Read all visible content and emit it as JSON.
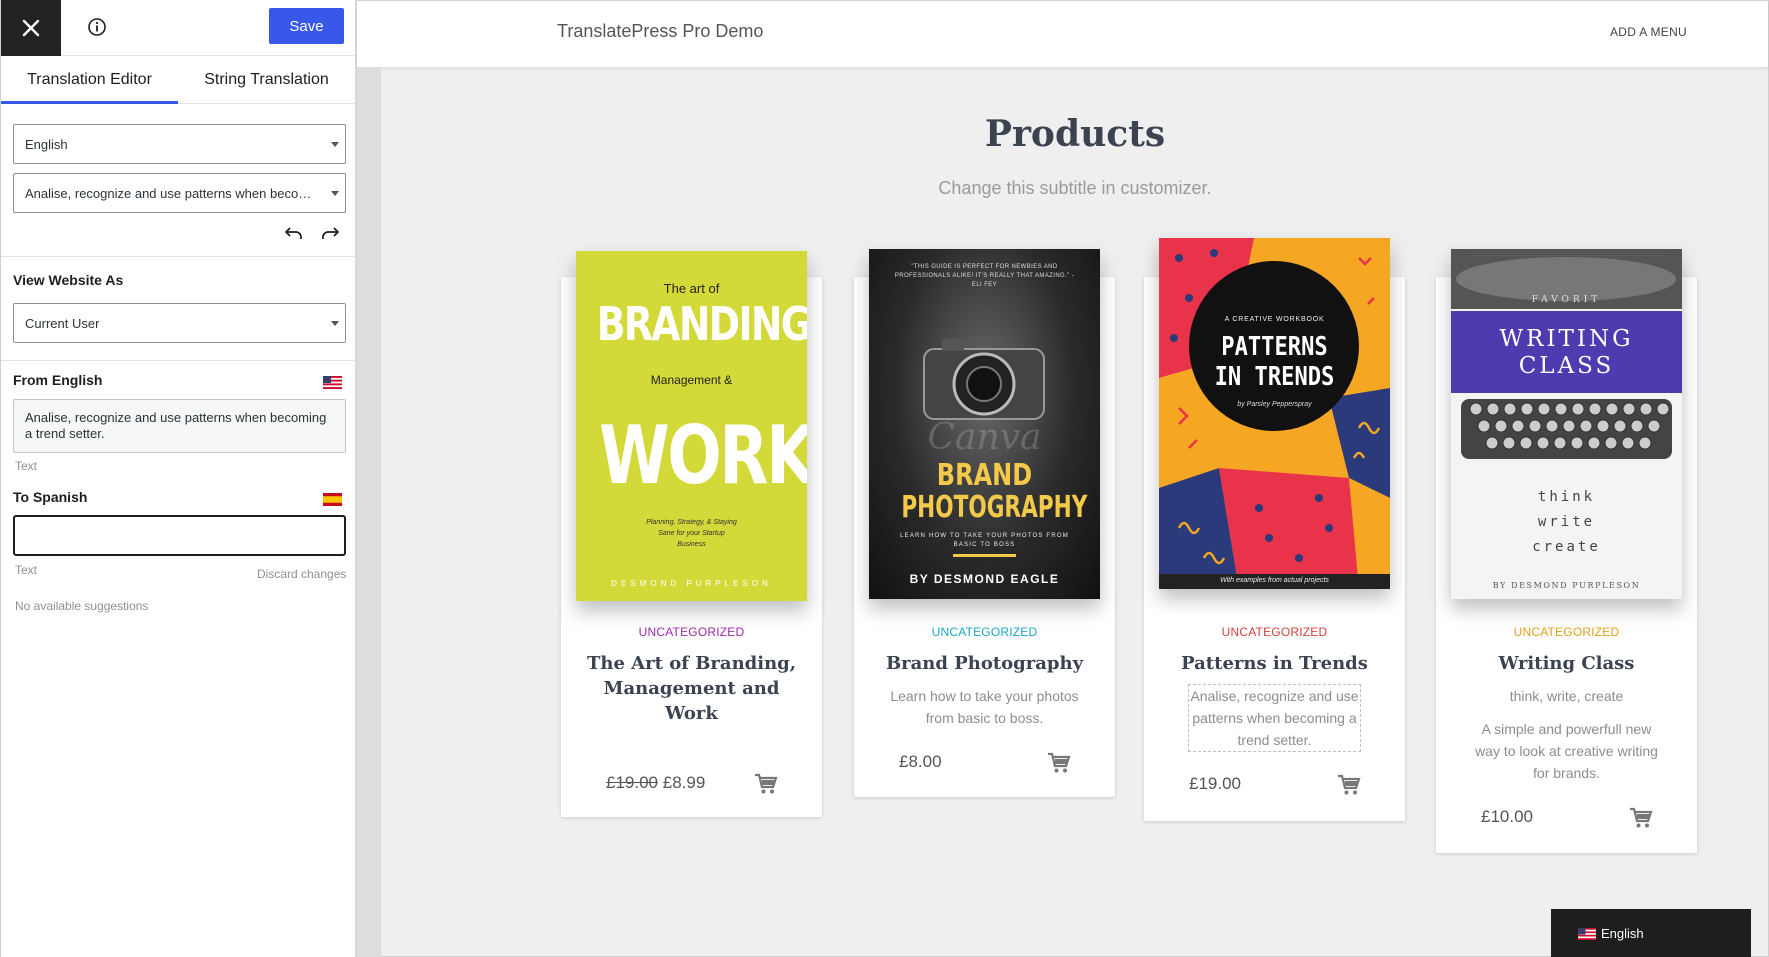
{
  "sidebar": {
    "save_label": "Save",
    "tabs": [
      {
        "label": "Translation Editor",
        "active": true
      },
      {
        "label": "String Translation",
        "active": false
      }
    ],
    "language_select": "English",
    "string_select": "Analise, recognize and use patterns when becoming a trend setter.",
    "view_as_label": "View Website As",
    "view_as_select": "Current User",
    "from_label": "From English",
    "from_text": "Analise, recognize and use patterns when becoming a trend setter.",
    "from_hint": "Text",
    "to_label": "To Spanish",
    "to_value": "",
    "to_hint": "Text",
    "discard_label": "Discard changes",
    "suggestions": "No available suggestions"
  },
  "site": {
    "title": "TranslatePress Pro Demo",
    "menu": "ADD A MENU",
    "page_title": "Products",
    "page_subtitle": "Change this subtitle in customizer.",
    "products": [
      {
        "category": "UNCATEGORIZED",
        "category_color": "#9b2aa8",
        "name": "The Art of Branding, Management and Work",
        "description": "",
        "old_price": "£19.00",
        "price": "£8.99",
        "cover": {
          "bg": "#d4d93a",
          "top": "The art of",
          "big1": "BRANDING",
          "mid": "Management &",
          "big2": "WORK",
          "small": "Planning, Strategy, & Staying Sane for your Startup Business",
          "author": "DESMOND PURPLESON"
        }
      },
      {
        "category": "UNCATEGORIZED",
        "category_color": "#1ca7c4",
        "name": "Brand Photography",
        "description": "Learn how to take your photos from basic to boss.",
        "old_price": "",
        "price": "£8.00",
        "cover": {
          "bg": "#1a1a1a",
          "quote": "\"THIS GUIDE IS PERFECT FOR NEWBIES AND PROFESSIONALS ALIKE! IT'S REALLY THAT AMAZING.\" - ELI FEY",
          "title1": "BRAND",
          "title2": "PHOTOGRAPHY",
          "tagline": "LEARN HOW TO TAKE YOUR PHOTOS FROM BASIC TO BOSS",
          "author": "BY DESMOND EAGLE",
          "watermark": "Canva"
        }
      },
      {
        "category": "UNCATEGORIZED",
        "category_color": "#d6403a",
        "name": "Patterns in Trends",
        "description": "Analise, recognize and use patterns when becoming a trend setter.",
        "old_price": "",
        "price": "£19.00",
        "cover": {
          "kicker": "A CREATIVE WORKBOOK",
          "title1": "PATTERNS",
          "title2": "IN TRENDS",
          "author": "by Parsley Pepperspray",
          "footer": "With examples from actual projects"
        }
      },
      {
        "category": "UNCATEGORIZED",
        "category_color": "#e0a018",
        "name": "Writing Class",
        "subtitle": "think, write, create",
        "description": "A simple and powerfull new way to look at creative writing for brands.",
        "old_price": "",
        "price": "£10.00",
        "cover": {
          "title1": "WRITING",
          "title2": "CLASS",
          "brand": "FAVORIT",
          "w1": "think",
          "w2": "write",
          "w3": "create",
          "author": "BY DESMOND PURPLESON"
        }
      }
    ],
    "language_switcher": "English"
  },
  "colors": {
    "accent": "#3858e9",
    "page_bg": "#efefef"
  }
}
